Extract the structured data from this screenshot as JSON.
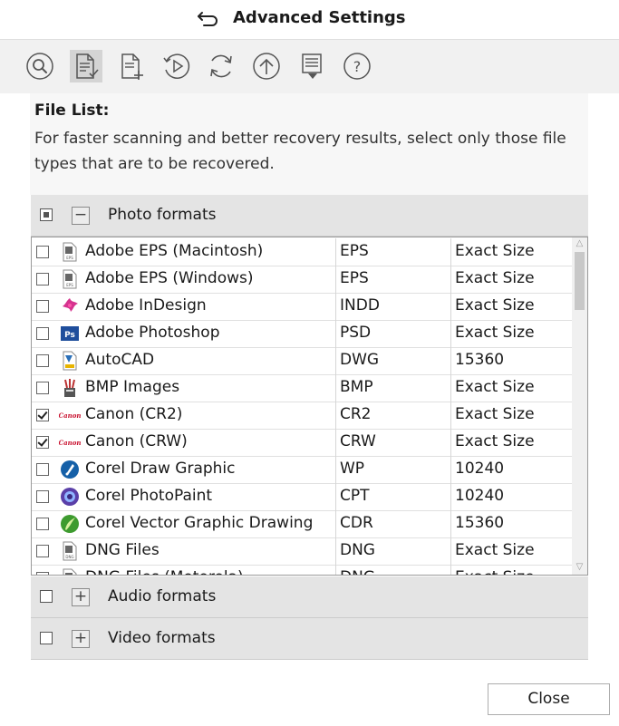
{
  "window": {
    "title": "Advanced Settings",
    "back_icon": "back-arrow-icon"
  },
  "toolbar": {
    "buttons": [
      {
        "name": "search-icon",
        "active": false
      },
      {
        "name": "file-list-icon",
        "active": true
      },
      {
        "name": "add-file-icon",
        "active": false
      },
      {
        "name": "resume-recovery-icon",
        "active": false
      },
      {
        "name": "refresh-icon",
        "active": false
      },
      {
        "name": "upload-icon",
        "active": false
      },
      {
        "name": "bookmark-icon",
        "active": false
      },
      {
        "name": "help-icon",
        "active": false
      }
    ]
  },
  "file_list": {
    "title": "File List:",
    "description": "For faster scanning and better recovery results, select only those file types that are to be recovered."
  },
  "groups": [
    {
      "label": "Photo formats",
      "toggle": "−",
      "expanded": true,
      "check_state": "partial"
    },
    {
      "label": "Audio formats",
      "toggle": "+",
      "expanded": false,
      "check_state": "unchecked"
    },
    {
      "label": "Video formats",
      "toggle": "+",
      "expanded": false,
      "check_state": "unchecked"
    }
  ],
  "photo_formats": [
    {
      "name": "Adobe EPS (Macintosh)",
      "ext": "EPS",
      "size": "Exact Size",
      "checked": false,
      "icon": "eps-file-icon"
    },
    {
      "name": "Adobe EPS (Windows)",
      "ext": "EPS",
      "size": "Exact Size",
      "checked": false,
      "icon": "eps-file-icon"
    },
    {
      "name": "Adobe InDesign",
      "ext": "INDD",
      "size": "Exact Size",
      "checked": false,
      "icon": "indesign-icon"
    },
    {
      "name": "Adobe Photoshop",
      "ext": "PSD",
      "size": "Exact Size",
      "checked": false,
      "icon": "photoshop-icon"
    },
    {
      "name": "AutoCAD",
      "ext": "DWG",
      "size": "15360",
      "checked": false,
      "icon": "autocad-icon"
    },
    {
      "name": "BMP Images",
      "ext": "BMP",
      "size": "Exact Size",
      "checked": false,
      "icon": "bmp-icon"
    },
    {
      "name": "Canon (CR2)",
      "ext": "CR2",
      "size": "Exact Size",
      "checked": true,
      "icon": "canon-logo-icon"
    },
    {
      "name": "Canon (CRW)",
      "ext": "CRW",
      "size": "Exact Size",
      "checked": true,
      "icon": "canon-logo-icon"
    },
    {
      "name": "Corel Draw Graphic",
      "ext": "WP",
      "size": "10240",
      "checked": false,
      "icon": "coreldraw-icon"
    },
    {
      "name": "Corel PhotoPaint",
      "ext": "CPT",
      "size": "10240",
      "checked": false,
      "icon": "photopaint-icon"
    },
    {
      "name": "Corel Vector Graphic Drawing",
      "ext": "CDR",
      "size": "15360",
      "checked": false,
      "icon": "corel-vector-icon"
    },
    {
      "name": "DNG Files",
      "ext": "DNG",
      "size": "Exact Size",
      "checked": false,
      "icon": "dng-file-icon"
    },
    {
      "name": "DNG Files (Motorola)",
      "ext": "DNG",
      "size": "Exact Size",
      "checked": false,
      "icon": "dng-file-icon"
    }
  ],
  "footer": {
    "close_label": "Close"
  },
  "colors": {
    "toolbar_bg": "#f1f1f1",
    "group_header_bg": "#e4e4e4",
    "icon_stroke": "#555555"
  }
}
